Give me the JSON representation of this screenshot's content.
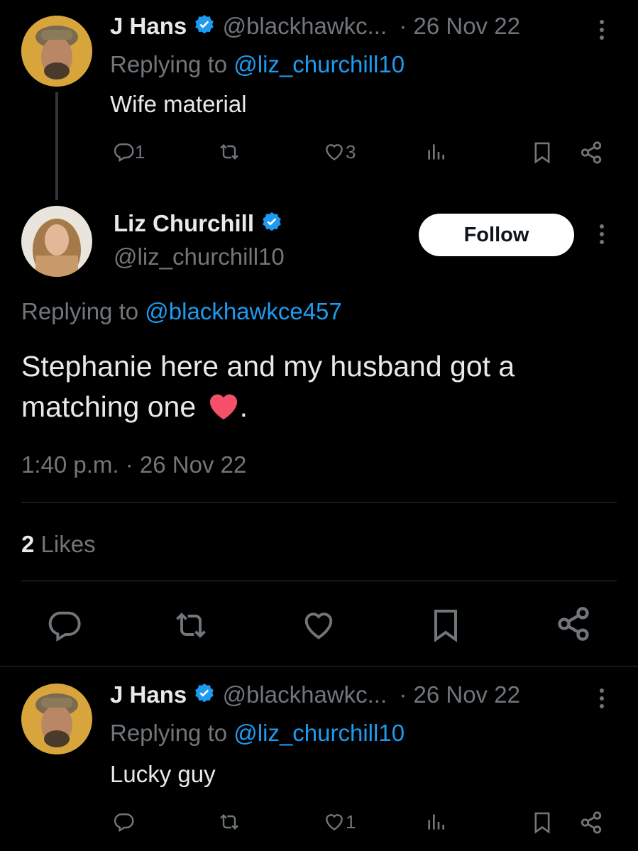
{
  "reply1": {
    "author_name": "J Hans",
    "handle": "@blackhawkc...",
    "date": "· 26 Nov 22",
    "replying_prefix": "Replying to",
    "replying_handle": "@liz_churchill10",
    "text": "Wife material",
    "actions": {
      "replies": "1",
      "retweets": "",
      "likes": "3"
    }
  },
  "main": {
    "author_name": "Liz Churchill",
    "handle": "@liz_churchill10",
    "follow_label": "Follow",
    "replying_prefix": "Replying to",
    "replying_handle": "@blackhawkce457",
    "text_line1": "Stephanie here and my husband got a",
    "text_line2": "matching one",
    "text_end": ".",
    "timestamp": "1:40 p.m. · 26 Nov 22",
    "likes_count": "2",
    "likes_label": "Likes"
  },
  "reply2": {
    "author_name": "J Hans",
    "handle": "@blackhawkc...",
    "date": "· 26 Nov 22",
    "replying_prefix": "Replying to",
    "replying_handle": "@liz_churchill10",
    "text": "Lucky guy",
    "actions": {
      "replies": "",
      "retweets": "",
      "likes": "1"
    }
  },
  "colors": {
    "background": "#000000",
    "accent": "#1d9bf0",
    "muted": "#71767b",
    "heart": "#f91880"
  }
}
